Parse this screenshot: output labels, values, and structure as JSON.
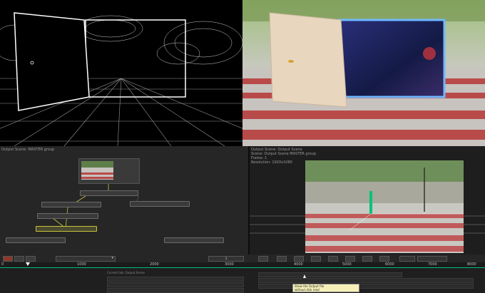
{
  "nodes_panel": {
    "header": "Output Scene: MASTER group"
  },
  "viewer_panel": {
    "header_lines": [
      "Output Scene: Output Scene",
      "Scene: Output Scene MASTER group",
      "Frame: 1",
      "Resolution: 1920x1080"
    ]
  },
  "node_labels": [
    "",
    "",
    "",
    "",
    "",
    "",
    ""
  ],
  "timeline": {
    "frame_readout": "1",
    "ruler": [
      "0",
      "1000",
      "2000",
      "3000",
      "4000",
      "5000",
      "6000",
      "7000",
      "8000"
    ]
  },
  "inspector": {
    "header": "Current tab: Output Scene",
    "tooltip_lines": [
      "Show the Output file",
      "without disk read"
    ]
  },
  "colors": {
    "accent": "#00c37a",
    "selected_node": "#c8c23a",
    "wire_link": "#c8c23a",
    "door_glow": "#4aa3ff"
  }
}
